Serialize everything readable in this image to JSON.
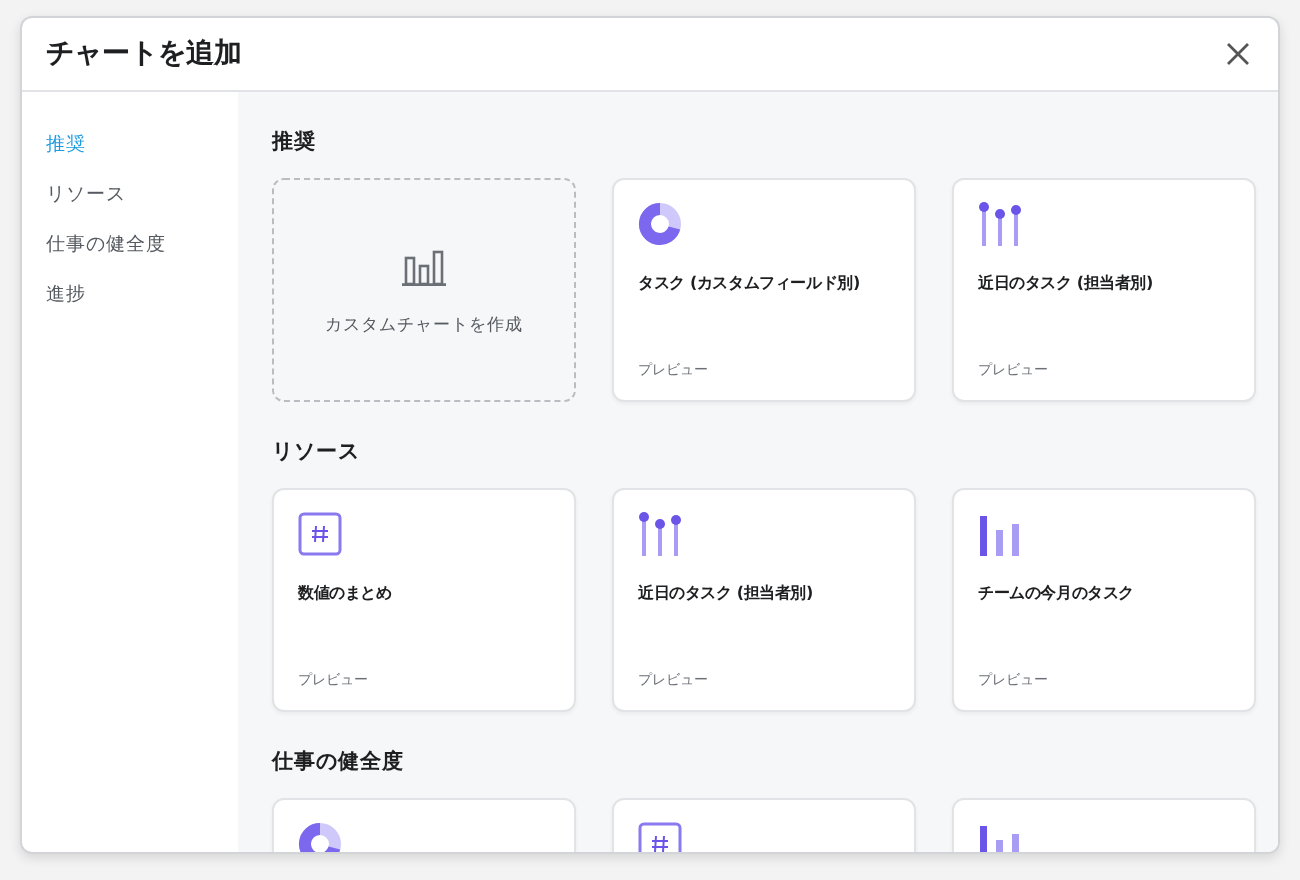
{
  "window": {
    "title": "チャートを追加"
  },
  "sidebar": {
    "items": [
      {
        "label": "推奨",
        "selected": true
      },
      {
        "label": "リソース",
        "selected": false
      },
      {
        "label": "仕事の健全度",
        "selected": false
      },
      {
        "label": "進捗",
        "selected": false
      }
    ]
  },
  "sections": [
    {
      "title": "推奨",
      "cards": [
        {
          "kind": "custom",
          "title": "カスタムチャートを作成"
        },
        {
          "kind": "donut",
          "title": "タスク (カスタムフィールド別)",
          "footer": "プレビュー"
        },
        {
          "kind": "lollipop",
          "title": "近日のタスク (担当者別)",
          "footer": "プレビュー"
        }
      ]
    },
    {
      "title": "リソース",
      "cards": [
        {
          "kind": "number",
          "title": "数値のまとめ",
          "footer": "プレビュー"
        },
        {
          "kind": "lollipop",
          "title": "近日のタスク (担当者別)",
          "footer": "プレビュー"
        },
        {
          "kind": "bars",
          "title": "チームの今月のタスク",
          "footer": "プレビュー"
        }
      ]
    },
    {
      "title": "仕事の健全度",
      "cards": [
        {
          "kind": "donut"
        },
        {
          "kind": "number"
        },
        {
          "kind": "bars"
        }
      ]
    }
  ]
}
